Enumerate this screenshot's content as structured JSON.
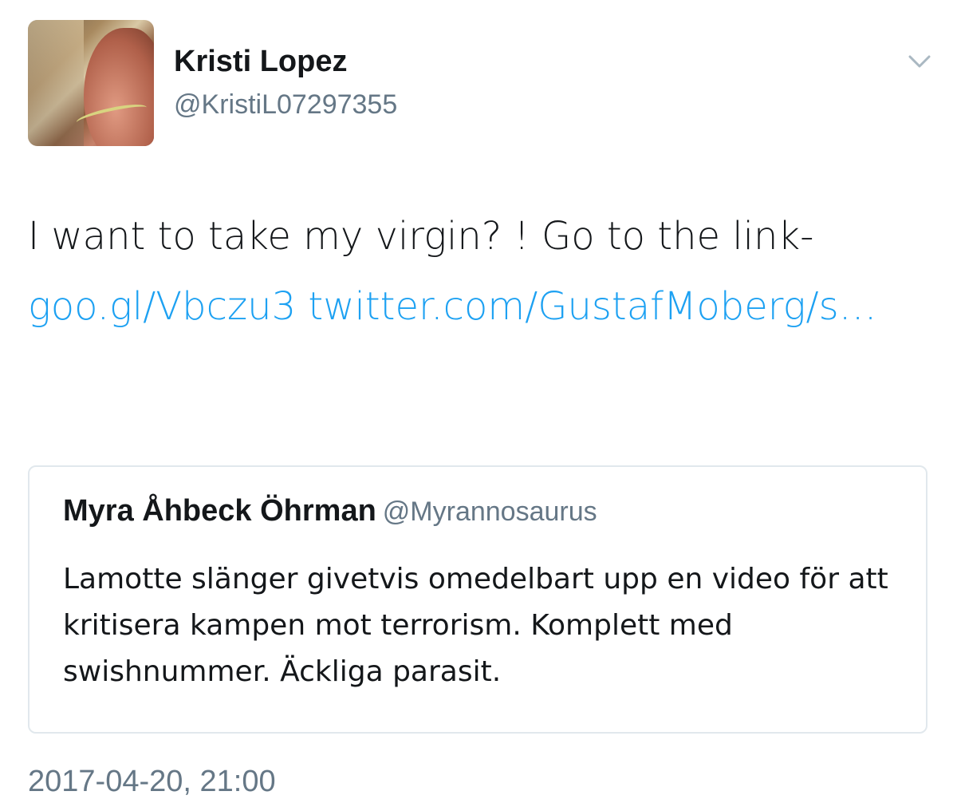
{
  "author": {
    "name": "Kristi Lopez",
    "handle": "@KristiL07297355"
  },
  "menu_icon": "chevron-down-icon",
  "tweet": {
    "text_prefix": "I want to take my virgin? !  Go to the link- ",
    "link1": "goo.gl/Vbczu3",
    "link2": "twitter.com/GustafMoberg/s…"
  },
  "quoted_tweet": {
    "name": "Myra Åhbeck Öhrman",
    "handle": "@Myrannosaurus",
    "text": "Lamotte slänger givetvis omedelbart upp en video för att kritisera kampen mot terrorism. Komplett med swishnummer. Äckliga parasit."
  },
  "timestamp": "2017-04-20, 21:00",
  "colors": {
    "link": "#1da1f2",
    "secondary_text": "#657786",
    "border": "#e1e8ed"
  }
}
